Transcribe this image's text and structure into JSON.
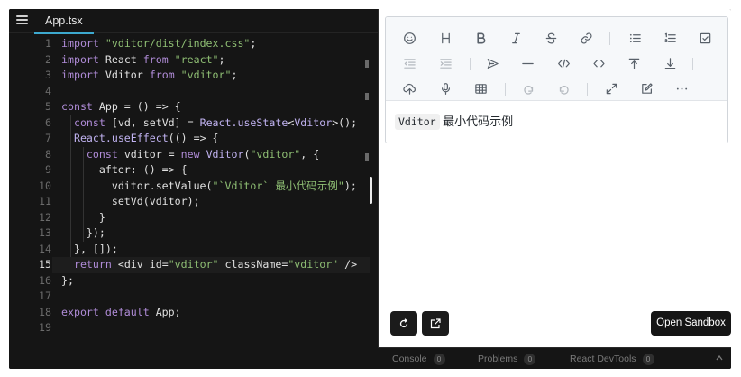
{
  "editor": {
    "tab_label": "App.tsx",
    "active_line": 15,
    "lines": [
      {
        "n": "1",
        "tokens": [
          [
            "kw",
            "import "
          ],
          [
            "str",
            "\"vditor/dist/index.css\""
          ],
          [
            "pl",
            ";"
          ]
        ]
      },
      {
        "n": "2",
        "tokens": [
          [
            "kw",
            "import "
          ],
          [
            "pl",
            "React "
          ],
          [
            "kw",
            "from "
          ],
          [
            "str",
            "\"react\""
          ],
          [
            "pl",
            ";"
          ]
        ]
      },
      {
        "n": "3",
        "tokens": [
          [
            "kw",
            "import "
          ],
          [
            "pl",
            "Vditor "
          ],
          [
            "kw",
            "from "
          ],
          [
            "str",
            "\"vditor\""
          ],
          [
            "pl",
            ";"
          ]
        ]
      },
      {
        "n": "4",
        "tokens": []
      },
      {
        "n": "5",
        "tokens": [
          [
            "kw",
            "const "
          ],
          [
            "pl",
            "App = () => {"
          ]
        ]
      },
      {
        "n": "6",
        "tokens": [
          [
            "pl",
            "  "
          ],
          [
            "kw",
            "const "
          ],
          [
            "pl",
            "[vd, setVd] = "
          ],
          [
            "fn",
            "React.useState"
          ],
          [
            "pl",
            "<"
          ],
          [
            "fn",
            "Vditor"
          ],
          [
            "pl",
            ">();"
          ]
        ]
      },
      {
        "n": "7",
        "tokens": [
          [
            "pl",
            "  "
          ],
          [
            "fn",
            "React.useEffect"
          ],
          [
            "pl",
            "(() => {"
          ]
        ]
      },
      {
        "n": "8",
        "tokens": [
          [
            "pl",
            "    "
          ],
          [
            "kw",
            "const "
          ],
          [
            "pl",
            "vditor = "
          ],
          [
            "kw",
            "new "
          ],
          [
            "fn",
            "Vditor"
          ],
          [
            "pl",
            "("
          ],
          [
            "str",
            "\"vditor\""
          ],
          [
            "pl",
            ", {"
          ]
        ]
      },
      {
        "n": "9",
        "tokens": [
          [
            "pl",
            "      after: () => {"
          ]
        ]
      },
      {
        "n": "10",
        "tokens": [
          [
            "pl",
            "        vditor.setValue("
          ],
          [
            "str",
            "\"`Vditor` 最小代码示例\""
          ],
          [
            "pl",
            ");"
          ]
        ]
      },
      {
        "n": "11",
        "tokens": [
          [
            "pl",
            "        setVd(vditor);"
          ]
        ]
      },
      {
        "n": "12",
        "tokens": [
          [
            "pl",
            "      }"
          ]
        ]
      },
      {
        "n": "13",
        "tokens": [
          [
            "pl",
            "    });"
          ]
        ]
      },
      {
        "n": "14",
        "tokens": [
          [
            "pl",
            "  }, []);"
          ]
        ]
      },
      {
        "n": "15",
        "tokens": [
          [
            "pl",
            "  "
          ],
          [
            "kw",
            "return "
          ],
          [
            "pl",
            "<div id="
          ],
          [
            "str",
            "\"vditor\""
          ],
          [
            "pl",
            " className="
          ],
          [
            "str",
            "\"vditor\""
          ],
          [
            "pl",
            " />"
          ]
        ]
      },
      {
        "n": "16",
        "tokens": [
          [
            "pl",
            "};"
          ]
        ]
      },
      {
        "n": "17",
        "tokens": []
      },
      {
        "n": "18",
        "tokens": [
          [
            "kw",
            "export default "
          ],
          [
            "pl",
            "App;"
          ]
        ]
      },
      {
        "n": "19",
        "tokens": []
      }
    ]
  },
  "preview": {
    "content_code": "Vditor",
    "content_text": " 最小代码示例",
    "open_sandbox_label": "Open Sandbox"
  },
  "toolbar_icons": {
    "row1": [
      "emoji-icon",
      "headings-icon",
      "bold-icon",
      "italic-icon",
      "strike-icon",
      "link-icon",
      "unordered-list-icon",
      "ordered-list-icon",
      "checklist-icon"
    ],
    "row2": [
      "outdent-icon",
      "indent-icon",
      "quote-icon",
      "horizontal-rule-icon",
      "code-block-icon",
      "inline-code-icon",
      "insert-before-icon",
      "insert-after-icon"
    ],
    "row3": [
      "upload-icon",
      "record-icon",
      "table-icon",
      "undo-icon",
      "redo-icon",
      "fullscreen-icon",
      "edit-mode-icon",
      "more-icon"
    ]
  },
  "bottombar": {
    "tabs": [
      {
        "label": "Console",
        "count": "0"
      },
      {
        "label": "Problems",
        "count": "0"
      },
      {
        "label": "React DevTools",
        "count": "0"
      }
    ]
  },
  "colors": {
    "keyword": "#b08cd8",
    "string": "#8fbf74",
    "tab_underline": "#3da9cf",
    "editor_bg": "#151515"
  }
}
